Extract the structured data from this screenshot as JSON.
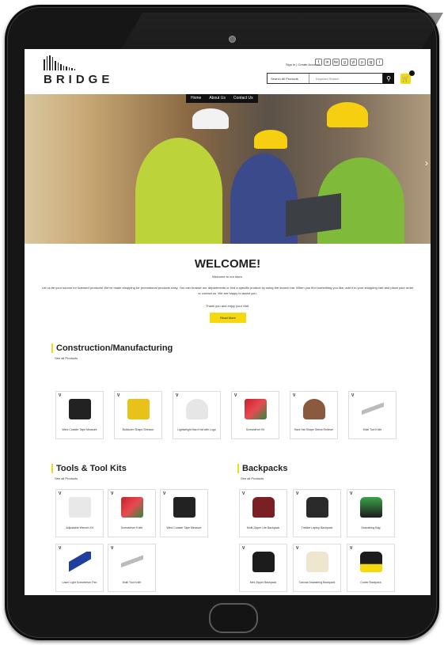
{
  "header": {
    "logo_text": "BRIDGE",
    "top_links": "Sign in  |  Create Account",
    "social_icons": [
      "f",
      "in",
      "tw",
      "g",
      "yt",
      "p",
      "ig",
      "t"
    ],
    "search": {
      "category": "Search All Products",
      "placeholder": "Keyword  Search"
    },
    "search_icon": "search-icon",
    "cart_icon": "cart-icon"
  },
  "nav": [
    "Home",
    "About Us",
    "Contact Us"
  ],
  "welcome": {
    "title": "WELCOME!",
    "subtitle": "Welcome to our store.",
    "description": "Let us be your source for licensed products! We've made shopping for promotional products easy. You can browse our departments or find a specific product by using the search bar. When you find something you like, add it to your shopping cart and place your order or contact us. We are happy to assist you.",
    "thanks": "Thank you and enjoy your visit.",
    "button": "Read More"
  },
  "sections": [
    {
      "title": "Construction/Manufacturing",
      "see_all": "See all Products",
      "items": [
        {
          "label": "Wind Coaster Tape Measure",
          "icon": "tape-measure-icon"
        },
        {
          "label": "Bulldozer Shape Stressor",
          "icon": "bulldozer-icon"
        },
        {
          "label": "Lightweight Hard Hat with Logo",
          "icon": "hard-hat-icon"
        },
        {
          "label": "Screwdriver Kit",
          "icon": "screwdriver-icon"
        },
        {
          "label": "Hard Hat Shape Stress Reliever",
          "icon": "hard-hat-icon"
        },
        {
          "label": "Multi Tool Knife",
          "icon": "tool-icon"
        }
      ]
    },
    {
      "title": "Tools & Tool Kits",
      "see_all": "See all Products",
      "items": [
        {
          "label": "Adjustable Wrench Kit",
          "icon": "wrench-icon"
        },
        {
          "label": "Screwdriver Knife",
          "icon": "screwdriver-icon"
        },
        {
          "label": "Wind Coaster Tape Measure",
          "icon": "tape-measure-icon"
        },
        {
          "label": "Laser Light Screwdriver Pen",
          "icon": "pen-icon"
        },
        {
          "label": "Multi Tool Knife",
          "icon": "tool-icon"
        }
      ]
    },
    {
      "title": "Backpacks",
      "see_all": "See all Products",
      "items": [
        {
          "label": "Multi-Zipper Lite Backpack",
          "icon": "backpack-icon"
        },
        {
          "label": "Trekker Laptop Backpack",
          "icon": "backpack-icon"
        },
        {
          "label": "Drawstring Bag",
          "icon": "backpack-icon"
        },
        {
          "label": "Mini Zipper Backpack",
          "icon": "backpack-icon"
        },
        {
          "label": "Canvas Drawstring Backpack",
          "icon": "backpack-icon"
        },
        {
          "label": "Cooler Backpack",
          "icon": "backpack-icon"
        }
      ]
    }
  ],
  "colors": {
    "accent": "#f5d90f",
    "text": "#222222"
  }
}
